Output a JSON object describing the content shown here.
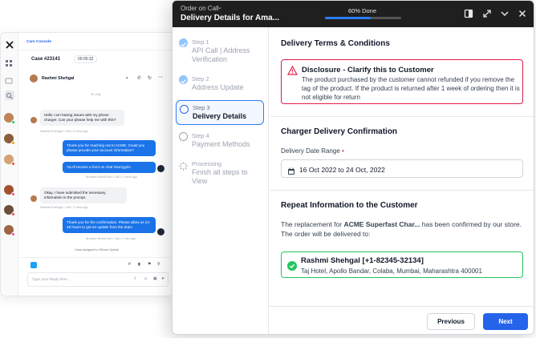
{
  "console": {
    "brand": "Care Console",
    "case_id": "Case #23141",
    "timer": "00:05:32",
    "contact_name": "Rashmi Shehgal",
    "date_divider": "20 July",
    "messages": [
      {
        "dir": "in",
        "text": "Hello I am having issues with my phone charger. Can your please help me with this?",
        "meta": "Rashmi Shehgal • Call • 5 mins ago"
      },
      {
        "dir": "out",
        "text": "Thank you for reaching out to ACME. Could you please provide your account information?",
        "meta": ""
      },
      {
        "dir": "out",
        "text": "You'll receive a form on chat #sorrygzio",
        "meta": "Browser Brand Bot • Call • 2 mins ago"
      },
      {
        "dir": "in",
        "text": "Okay, I have submitted the necessary information in the prompt.",
        "meta": "Rashmi Shehgal • Call • 2 mins ago"
      },
      {
        "dir": "out",
        "text": "Thank you for the confirmation. Please allow us 24-48 hours to get an update from the team",
        "meta": "Browser Brand Bot • Call • 1 min ago"
      }
    ],
    "assigned_note": "Case Assigned to Shiven Sprinkl",
    "reply_placeholder": "Type your Reply here ..."
  },
  "modal": {
    "subtitle": "Order on Call",
    "title": "Delivery Details for Ama...",
    "progress_label": "60% Done",
    "progress_fraction": 0.6,
    "steps": [
      {
        "num": "Step 1",
        "label": "API Call | Address Verification",
        "state": "done"
      },
      {
        "num": "Step 2",
        "label": "Address Update",
        "state": "done"
      },
      {
        "num": "Step 3",
        "label": "Delivery Details",
        "state": "active"
      },
      {
        "num": "Step 4",
        "label": "Payment Methods",
        "state": "pending"
      },
      {
        "num": "Processing",
        "label": "Finish all steps to View",
        "state": "processing"
      }
    ],
    "terms": {
      "heading": "Delivery Terms & Conditions",
      "alert_title": "Disclosure - Clarify this to Customer",
      "alert_body": "The product purchased by the customer cannot refunded if you remove the tag of the product. If the product is returned after 1 week of ordering then it is not eligible for return"
    },
    "charger": {
      "heading": "Charger Delivery Confirmation",
      "date_label": "Delivery Date Range",
      "required_mark": "•",
      "date_value": "16 Oct 2022 to 24 Oct, 2022"
    },
    "repeat": {
      "heading": "Repeat Information to the Customer",
      "text_prefix": "The replacement for ",
      "text_product": "ACME Superfast Char...",
      "text_suffix": " has been confirmed by our store. The order will be delivered to:",
      "customer_name": "Rashmi Shehgal [+1-82345-32134]",
      "customer_address": "Taj Hotel, Apollo Bandar, Colaba, Mumbai, Maharashtra 400001"
    },
    "footer": {
      "previous_label": "Previous",
      "next_label": "Next"
    }
  },
  "colors": {
    "accent": "#2563eb",
    "alert_border": "#e11d48",
    "success": "#22c55e",
    "header_bg": "#1f1f1f"
  }
}
